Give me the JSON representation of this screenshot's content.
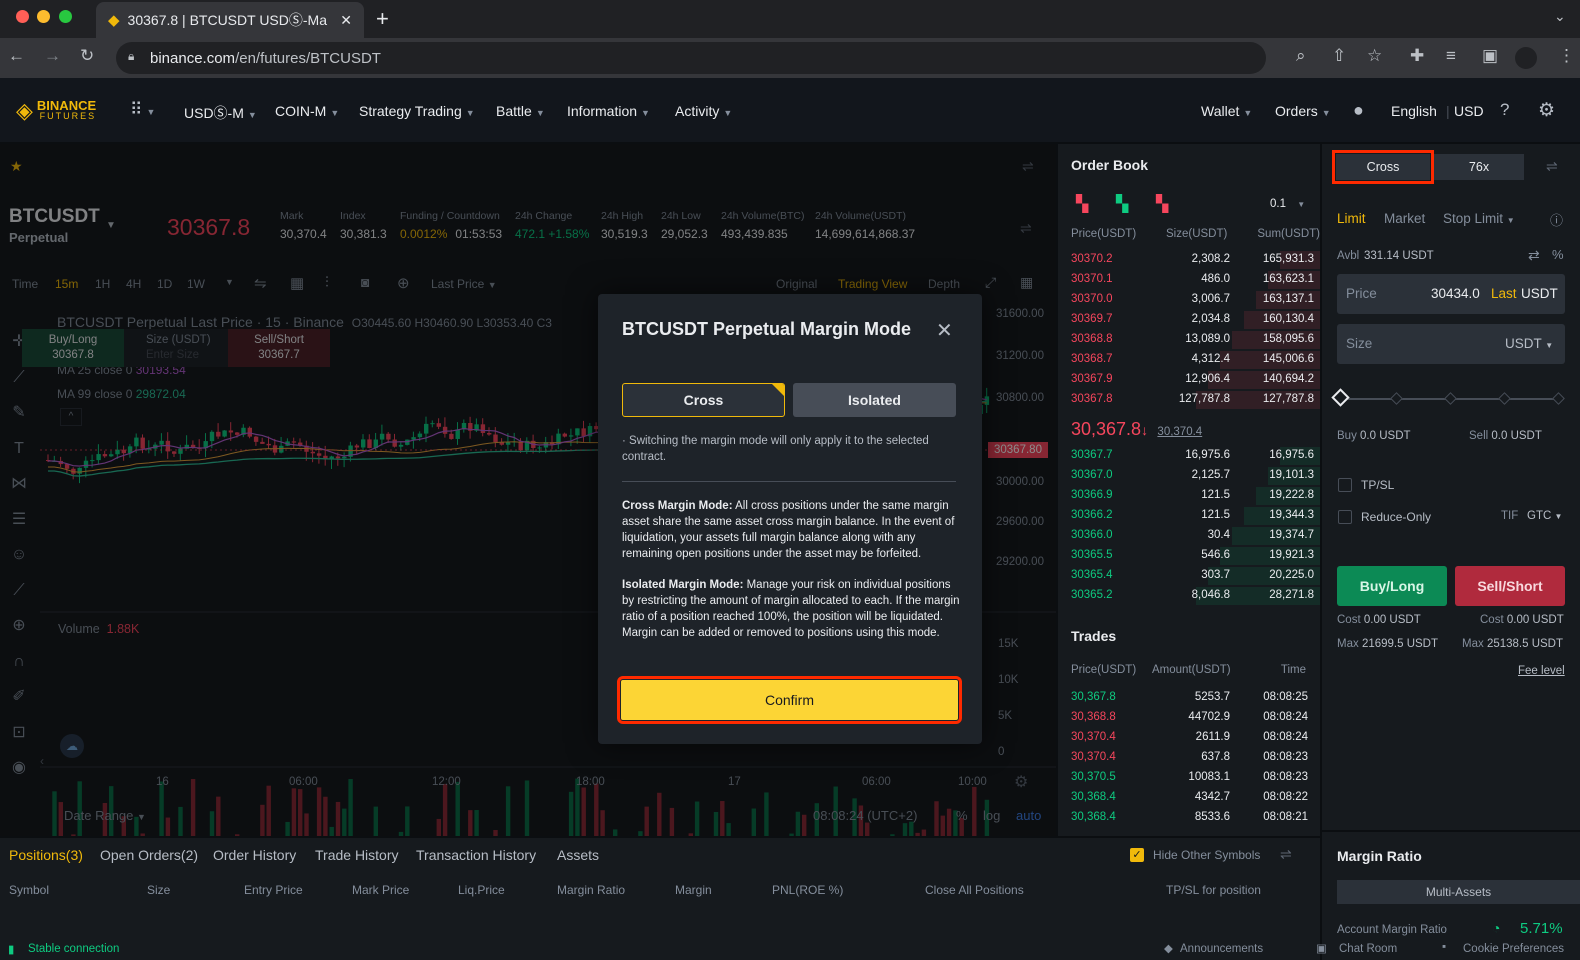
{
  "browser": {
    "tab_title": "30367.8 | BTCUSDT USDⓈ-Ma",
    "url_host": "binance.com",
    "url_path": "/en/futures/BTCUSDT"
  },
  "nav": {
    "logo_top": "BINANCE",
    "logo_bottom": "FUTURES",
    "items": [
      "USDⓈ-M",
      "COIN-M",
      "Strategy Trading",
      "Battle",
      "Information",
      "Activity"
    ],
    "wallet": "Wallet",
    "orders": "Orders",
    "language": "English",
    "currency": "USD"
  },
  "ticker": {
    "symbol": "BTCUSDT",
    "subtitle": "Perpetual",
    "price": "30367.8",
    "stats": [
      {
        "label": "Mark",
        "value": "30,370.4",
        "vcolor": "#eaecef"
      },
      {
        "label": "Index",
        "value": "30,381.3",
        "vcolor": "#eaecef"
      },
      {
        "label": "Funding / Countdown",
        "value": "0.0012%",
        "value2": "01:53:53",
        "vcolor": "#f0b90b"
      },
      {
        "label": "24h Change",
        "value": "472.1 +1.58%",
        "vcolor": "#0ecb81"
      },
      {
        "label": "24h High",
        "value": "30,519.3",
        "vcolor": "#eaecef"
      },
      {
        "label": "24h Low",
        "value": "29,052.3",
        "vcolor": "#eaecef"
      },
      {
        "label": "24h Volume(BTC)",
        "value": "493,439.835",
        "vcolor": "#eaecef"
      },
      {
        "label": "24h Volume(USDT)",
        "value": "14,699,614,868.37",
        "vcolor": "#eaecef"
      }
    ]
  },
  "chart_toolbar": {
    "time": "Time",
    "intervals": [
      "15m",
      "1H",
      "4H",
      "1D",
      "1W"
    ],
    "last_price": "Last Price",
    "views": [
      "Original",
      "Trading View",
      "Depth"
    ]
  },
  "chart": {
    "legend": "BTCUSDT Perpetual Last Price · 15 · Binance",
    "ohlc": "O30445.60 H30460.90 L30353.40 C3",
    "ma25": "MA 25 close 0",
    "ma25v": "30193.54",
    "ma99": "MA 99 close 0",
    "ma99v": "29872.04",
    "price_ticks": [
      "31600.00",
      "31200.00",
      "30800.00",
      "30000.00",
      "29600.00",
      "29200.00"
    ],
    "last_label": "30367.80",
    "volume_label": "Volume",
    "volume_value": "1.88K",
    "vol_ticks": [
      "15K",
      "10K",
      "5K",
      "0"
    ],
    "time_ticks": [
      "16",
      "06:00",
      "12:00",
      "18:00",
      "17",
      "06:00",
      "10:00"
    ],
    "date_range": "Date Range",
    "clock": "08:08:24 (UTC+2)",
    "scale_opts": [
      "%",
      "log",
      "auto"
    ]
  },
  "quick": {
    "buy": "Buy/Long",
    "buy_price": "30367.8",
    "size": "Size (USDT)",
    "size_ph": "Enter Size",
    "sell": "Sell/Short",
    "sell_price": "30367.7"
  },
  "orderbook": {
    "title": "Order Book",
    "precision": "0.1",
    "headers": [
      "Price(USDT)",
      "Size(USDT)",
      "Sum(USDT)"
    ],
    "asks": [
      [
        "30370.2",
        "2,308.2",
        "165,931.3"
      ],
      [
        "30370.1",
        "486.0",
        "163,623.1"
      ],
      [
        "30370.0",
        "3,006.7",
        "163,137.1"
      ],
      [
        "30369.7",
        "2,034.8",
        "160,130.4"
      ],
      [
        "30368.8",
        "13,089.0",
        "158,095.6"
      ],
      [
        "30368.7",
        "4,312.4",
        "145,006.6"
      ],
      [
        "30367.9",
        "12,906.4",
        "140,694.2"
      ],
      [
        "30367.8",
        "127,787.8",
        "127,787.8"
      ]
    ],
    "mid_price": "30,367.8",
    "mid_mark": "30,370.4",
    "bids": [
      [
        "30367.7",
        "16,975.6",
        "16,975.6"
      ],
      [
        "30367.0",
        "2,125.7",
        "19,101.3"
      ],
      [
        "30366.9",
        "121.5",
        "19,222.8"
      ],
      [
        "30366.2",
        "121.5",
        "19,344.3"
      ],
      [
        "30366.0",
        "30.4",
        "19,374.7"
      ],
      [
        "30365.5",
        "546.6",
        "19,921.3"
      ],
      [
        "30365.4",
        "303.7",
        "20,225.0"
      ],
      [
        "30365.2",
        "8,046.8",
        "28,271.8"
      ]
    ]
  },
  "trades": {
    "title": "Trades",
    "headers": [
      "Price(USDT)",
      "Amount(USDT)",
      "Time"
    ],
    "rows": [
      [
        "30,367.8",
        "5253.7",
        "08:08:25",
        "g"
      ],
      [
        "30,368.8",
        "44702.9",
        "08:08:24",
        "r"
      ],
      [
        "30,370.4",
        "2611.9",
        "08:08:24",
        "r"
      ],
      [
        "30,370.4",
        "637.8",
        "08:08:23",
        "r"
      ],
      [
        "30,370.5",
        "10083.1",
        "08:08:23",
        "g"
      ],
      [
        "30,368.4",
        "4342.7",
        "08:08:22",
        "g"
      ],
      [
        "30,368.4",
        "8533.6",
        "08:08:21",
        "g"
      ]
    ]
  },
  "trade_panel": {
    "margin_mode": "Cross",
    "leverage": "76x",
    "order_types": [
      "Limit",
      "Market",
      "Stop Limit"
    ],
    "avbl_label": "Avbl",
    "avbl": "331.14 USDT",
    "price_label": "Price",
    "price_value": "30434.0",
    "last": "Last",
    "unit": "USDT",
    "size_label": "Size",
    "buy_label": "Buy",
    "buy_value": "0.0 USDT",
    "sell_label": "Sell",
    "sell_value": "0.0 USDT",
    "tpsl": "TP/SL",
    "reduce_only": "Reduce-Only",
    "tif": "TIF",
    "tif_value": "GTC",
    "buy_btn": "Buy/Long",
    "sell_btn": "Sell/Short",
    "cost_label": "Cost",
    "cost_buy": "0.00 USDT",
    "cost_sell": "0.00 USDT",
    "max_label": "Max",
    "max_buy": "21699.5 USDT",
    "max_sell": "25138.5 USDT",
    "fee_level": "Fee level",
    "margin_ratio_title": "Margin Ratio",
    "multi_assets": "Multi-Assets",
    "account_margin_ratio": "Account Margin Ratio",
    "ratio_value": "5.71%"
  },
  "positions": {
    "tabs": [
      "Positions(3)",
      "Open Orders(2)",
      "Order History",
      "Trade History",
      "Transaction History",
      "Assets"
    ],
    "hide_other": "Hide Other Symbols",
    "columns": [
      "Symbol",
      "Size",
      "Entry Price",
      "Mark Price",
      "Liq.Price",
      "Margin Ratio",
      "Margin",
      "PNL(ROE %)",
      "Close All Positions",
      "TP/SL for position"
    ]
  },
  "footer": {
    "status": "Stable connection",
    "links": [
      "Announcements",
      "Chat Room",
      "Cookie Preferences"
    ]
  },
  "modal": {
    "title": "BTCUSDT Perpetual Margin Mode",
    "opt_cross": "Cross",
    "opt_isolated": "Isolated",
    "note": "· Switching the margin mode will only apply it to the selected contract.",
    "cross_title": "Cross Margin Mode:",
    "cross_text": " All cross positions under the same margin asset share the same asset cross margin balance. In the event of liquidation, your assets full margin balance along with any remaining open positions under the asset may be forfeited.",
    "iso_title": "Isolated Margin Mode:",
    "iso_text": " Manage your risk on individual positions by restricting the amount of margin allocated to each. If the margin ratio of a position reached 100%, the position will be liquidated. Margin can be added or removed to positions using this mode.",
    "confirm": "Confirm"
  },
  "colors": {
    "accent": "#f0b90b",
    "buy": "#0ecb81",
    "sell": "#f6465d",
    "highlight": "#ff2a00"
  }
}
